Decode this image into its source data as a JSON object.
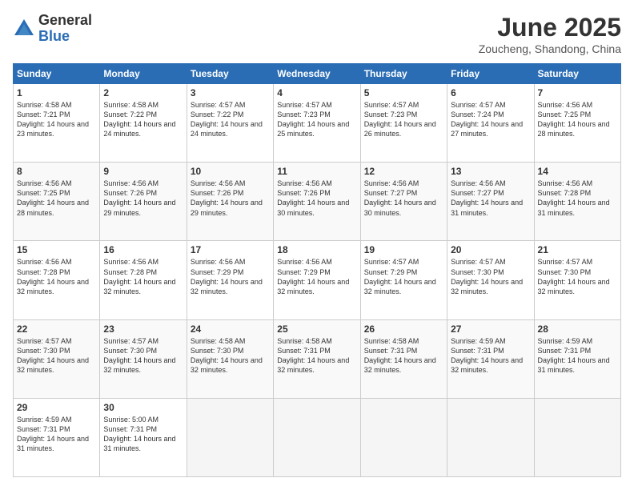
{
  "header": {
    "logo_general": "General",
    "logo_blue": "Blue",
    "month": "June 2025",
    "location": "Zoucheng, Shandong, China"
  },
  "weekdays": [
    "Sunday",
    "Monday",
    "Tuesday",
    "Wednesday",
    "Thursday",
    "Friday",
    "Saturday"
  ],
  "weeks": [
    [
      {
        "day": "1",
        "sunrise": "Sunrise: 4:58 AM",
        "sunset": "Sunset: 7:21 PM",
        "daylight": "Daylight: 14 hours and 23 minutes."
      },
      {
        "day": "2",
        "sunrise": "Sunrise: 4:58 AM",
        "sunset": "Sunset: 7:22 PM",
        "daylight": "Daylight: 14 hours and 24 minutes."
      },
      {
        "day": "3",
        "sunrise": "Sunrise: 4:57 AM",
        "sunset": "Sunset: 7:22 PM",
        "daylight": "Daylight: 14 hours and 24 minutes."
      },
      {
        "day": "4",
        "sunrise": "Sunrise: 4:57 AM",
        "sunset": "Sunset: 7:23 PM",
        "daylight": "Daylight: 14 hours and 25 minutes."
      },
      {
        "day": "5",
        "sunrise": "Sunrise: 4:57 AM",
        "sunset": "Sunset: 7:23 PM",
        "daylight": "Daylight: 14 hours and 26 minutes."
      },
      {
        "day": "6",
        "sunrise": "Sunrise: 4:57 AM",
        "sunset": "Sunset: 7:24 PM",
        "daylight": "Daylight: 14 hours and 27 minutes."
      },
      {
        "day": "7",
        "sunrise": "Sunrise: 4:56 AM",
        "sunset": "Sunset: 7:25 PM",
        "daylight": "Daylight: 14 hours and 28 minutes."
      }
    ],
    [
      {
        "day": "8",
        "sunrise": "Sunrise: 4:56 AM",
        "sunset": "Sunset: 7:25 PM",
        "daylight": "Daylight: 14 hours and 28 minutes."
      },
      {
        "day": "9",
        "sunrise": "Sunrise: 4:56 AM",
        "sunset": "Sunset: 7:26 PM",
        "daylight": "Daylight: 14 hours and 29 minutes."
      },
      {
        "day": "10",
        "sunrise": "Sunrise: 4:56 AM",
        "sunset": "Sunset: 7:26 PM",
        "daylight": "Daylight: 14 hours and 29 minutes."
      },
      {
        "day": "11",
        "sunrise": "Sunrise: 4:56 AM",
        "sunset": "Sunset: 7:26 PM",
        "daylight": "Daylight: 14 hours and 30 minutes."
      },
      {
        "day": "12",
        "sunrise": "Sunrise: 4:56 AM",
        "sunset": "Sunset: 7:27 PM",
        "daylight": "Daylight: 14 hours and 30 minutes."
      },
      {
        "day": "13",
        "sunrise": "Sunrise: 4:56 AM",
        "sunset": "Sunset: 7:27 PM",
        "daylight": "Daylight: 14 hours and 31 minutes."
      },
      {
        "day": "14",
        "sunrise": "Sunrise: 4:56 AM",
        "sunset": "Sunset: 7:28 PM",
        "daylight": "Daylight: 14 hours and 31 minutes."
      }
    ],
    [
      {
        "day": "15",
        "sunrise": "Sunrise: 4:56 AM",
        "sunset": "Sunset: 7:28 PM",
        "daylight": "Daylight: 14 hours and 32 minutes."
      },
      {
        "day": "16",
        "sunrise": "Sunrise: 4:56 AM",
        "sunset": "Sunset: 7:28 PM",
        "daylight": "Daylight: 14 hours and 32 minutes."
      },
      {
        "day": "17",
        "sunrise": "Sunrise: 4:56 AM",
        "sunset": "Sunset: 7:29 PM",
        "daylight": "Daylight: 14 hours and 32 minutes."
      },
      {
        "day": "18",
        "sunrise": "Sunrise: 4:56 AM",
        "sunset": "Sunset: 7:29 PM",
        "daylight": "Daylight: 14 hours and 32 minutes."
      },
      {
        "day": "19",
        "sunrise": "Sunrise: 4:57 AM",
        "sunset": "Sunset: 7:29 PM",
        "daylight": "Daylight: 14 hours and 32 minutes."
      },
      {
        "day": "20",
        "sunrise": "Sunrise: 4:57 AM",
        "sunset": "Sunset: 7:30 PM",
        "daylight": "Daylight: 14 hours and 32 minutes."
      },
      {
        "day": "21",
        "sunrise": "Sunrise: 4:57 AM",
        "sunset": "Sunset: 7:30 PM",
        "daylight": "Daylight: 14 hours and 32 minutes."
      }
    ],
    [
      {
        "day": "22",
        "sunrise": "Sunrise: 4:57 AM",
        "sunset": "Sunset: 7:30 PM",
        "daylight": "Daylight: 14 hours and 32 minutes."
      },
      {
        "day": "23",
        "sunrise": "Sunrise: 4:57 AM",
        "sunset": "Sunset: 7:30 PM",
        "daylight": "Daylight: 14 hours and 32 minutes."
      },
      {
        "day": "24",
        "sunrise": "Sunrise: 4:58 AM",
        "sunset": "Sunset: 7:30 PM",
        "daylight": "Daylight: 14 hours and 32 minutes."
      },
      {
        "day": "25",
        "sunrise": "Sunrise: 4:58 AM",
        "sunset": "Sunset: 7:31 PM",
        "daylight": "Daylight: 14 hours and 32 minutes."
      },
      {
        "day": "26",
        "sunrise": "Sunrise: 4:58 AM",
        "sunset": "Sunset: 7:31 PM",
        "daylight": "Daylight: 14 hours and 32 minutes."
      },
      {
        "day": "27",
        "sunrise": "Sunrise: 4:59 AM",
        "sunset": "Sunset: 7:31 PM",
        "daylight": "Daylight: 14 hours and 32 minutes."
      },
      {
        "day": "28",
        "sunrise": "Sunrise: 4:59 AM",
        "sunset": "Sunset: 7:31 PM",
        "daylight": "Daylight: 14 hours and 31 minutes."
      }
    ],
    [
      {
        "day": "29",
        "sunrise": "Sunrise: 4:59 AM",
        "sunset": "Sunset: 7:31 PM",
        "daylight": "Daylight: 14 hours and 31 minutes."
      },
      {
        "day": "30",
        "sunrise": "Sunrise: 5:00 AM",
        "sunset": "Sunset: 7:31 PM",
        "daylight": "Daylight: 14 hours and 31 minutes."
      },
      null,
      null,
      null,
      null,
      null
    ]
  ]
}
